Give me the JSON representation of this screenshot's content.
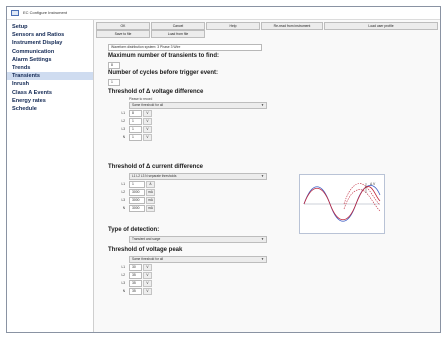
{
  "window": {
    "title": "EC Configure Instrument"
  },
  "sidebar": {
    "items": [
      {
        "label": "Setup"
      },
      {
        "label": "Sensors and Ratios"
      },
      {
        "label": "Instrument Display"
      },
      {
        "label": "Communication"
      },
      {
        "label": "Alarm Settings"
      },
      {
        "label": "Trends"
      },
      {
        "label": "Transients"
      },
      {
        "label": "Inrush"
      },
      {
        "label": "Class A Events"
      },
      {
        "label": "Energy rates"
      },
      {
        "label": "Schedule"
      }
    ]
  },
  "toolbar": {
    "ok": "OK",
    "cancel": "Cancel",
    "help": "Help",
    "reset": "Re-read from instrument",
    "load_user": "Load user profile",
    "save_file": "Save to file",
    "load_file": "Load from file"
  },
  "form": {
    "info": "Waveform distribution system: 3 Phase 3 Wire",
    "max_transients": {
      "label": "Maximum number of transients to find:",
      "value": "8"
    },
    "cycles_before": {
      "label": "Number of cycles before trigger event:",
      "value": "1"
    },
    "voltage_diff": {
      "heading": "Threshold of Δ voltage difference",
      "note": "Please to record",
      "mode": "Same threshold for all",
      "rows": [
        {
          "label": "L1",
          "value": "8",
          "unit": "V"
        },
        {
          "label": "L2",
          "value": "1",
          "unit": "V"
        },
        {
          "label": "L3",
          "value": "1",
          "unit": "V"
        },
        {
          "label": "N",
          "value": "1",
          "unit": "V"
        }
      ]
    },
    "current_diff": {
      "heading": "Threshold of Δ current difference",
      "mode": "L1 L2 L3 N separate thresholds",
      "rows": [
        {
          "label": "L1",
          "value": "1",
          "unit": "A"
        },
        {
          "label": "L2",
          "value": "3000",
          "unit": "mA"
        },
        {
          "label": "L3",
          "value": "3000",
          "unit": "mA"
        },
        {
          "label": "N",
          "value": "3000",
          "unit": "mA"
        }
      ]
    },
    "detection": {
      "heading": "Type of detection:",
      "value": "Transient and surge"
    },
    "voltage_peak": {
      "heading": "Threshold of voltage peak",
      "mode": "Same threshold for all",
      "rows": [
        {
          "label": "L1",
          "value": "30",
          "unit": "V"
        },
        {
          "label": "L2",
          "value": "35",
          "unit": "V"
        },
        {
          "label": "L3",
          "value": "35",
          "unit": "V"
        },
        {
          "label": "N",
          "value": "35",
          "unit": "V"
        }
      ]
    }
  },
  "diagram": {
    "label": "Δ V"
  },
  "colors": {
    "nav_text": "#142a55",
    "active_bg": "#cfdcf0",
    "wave_red": "#c0263a",
    "wave_blue": "#3b5bc4"
  }
}
